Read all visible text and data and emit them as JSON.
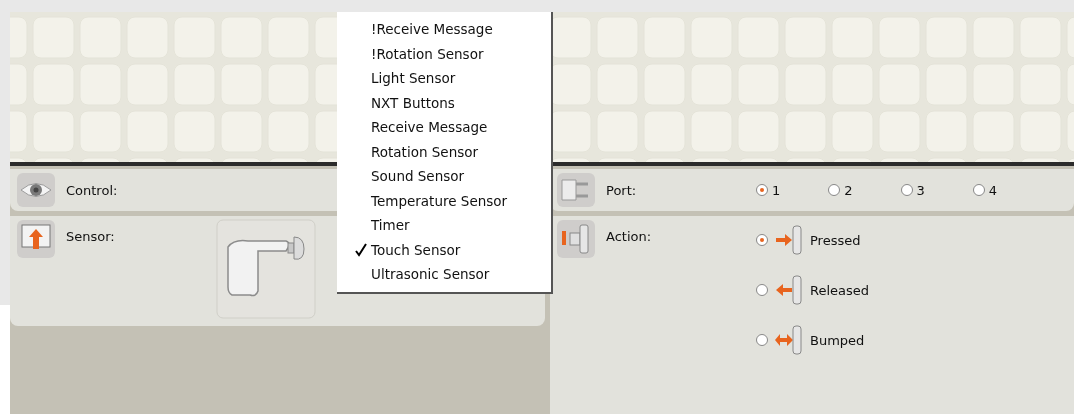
{
  "menu": {
    "items": [
      {
        "label": "!Receive Message",
        "checked": false
      },
      {
        "label": "!Rotation Sensor",
        "checked": false
      },
      {
        "label": "Light Sensor",
        "checked": false
      },
      {
        "label": "NXT Buttons",
        "checked": false
      },
      {
        "label": "Receive Message",
        "checked": false
      },
      {
        "label": "Rotation Sensor",
        "checked": false
      },
      {
        "label": "Sound Sensor",
        "checked": false
      },
      {
        "label": "Temperature Sensor",
        "checked": false
      },
      {
        "label": "Timer",
        "checked": false
      },
      {
        "label": "Touch Sensor",
        "checked": true
      },
      {
        "label": "Ultrasonic Sensor",
        "checked": false
      }
    ]
  },
  "control": {
    "label": "Control:"
  },
  "sensor": {
    "label": "Sensor:"
  },
  "port": {
    "label": "Port:",
    "options": [
      {
        "label": "1",
        "selected": true
      },
      {
        "label": "2",
        "selected": false
      },
      {
        "label": "3",
        "selected": false
      },
      {
        "label": "4",
        "selected": false
      }
    ]
  },
  "action": {
    "label": "Action:",
    "options": [
      {
        "label": "Pressed",
        "kind": "pressed",
        "selected": true
      },
      {
        "label": "Released",
        "kind": "released",
        "selected": false
      },
      {
        "label": "Bumped",
        "kind": "bumped",
        "selected": false
      }
    ]
  }
}
